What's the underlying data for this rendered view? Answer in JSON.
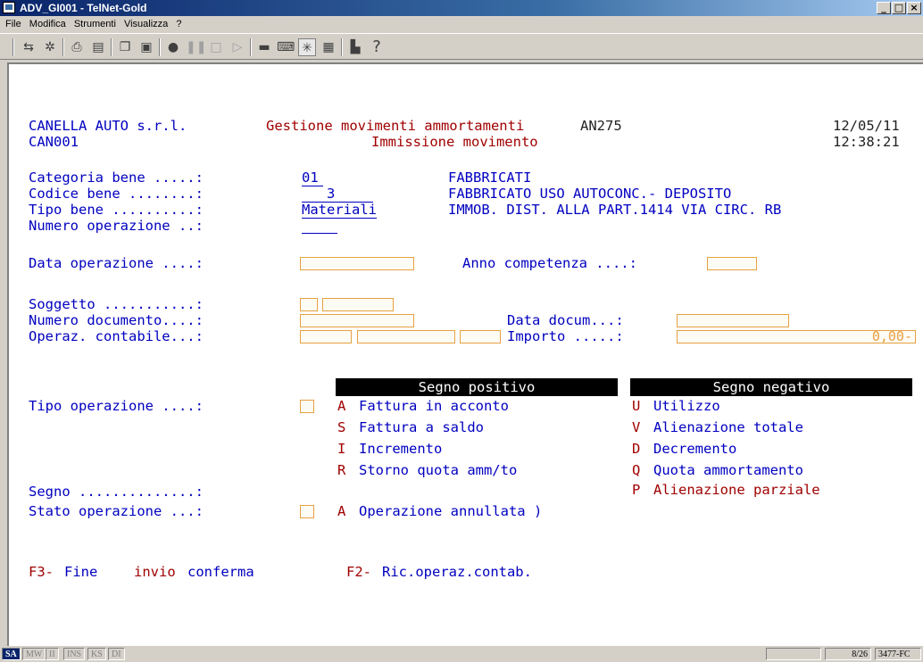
{
  "window": {
    "title": "ADV_GI001 - TelNet-Gold",
    "min": "_",
    "max": "□",
    "close": "×"
  },
  "menu": [
    "File",
    "Modifica",
    "Strumenti",
    "Visualizza",
    "?"
  ],
  "header": {
    "company": "CANELLA AUTO s.r.l.",
    "company_code": "CAN001",
    "program_title": "Gestione movimenti ammortamenti",
    "program_code": "AN275",
    "subtitle": "Immissione movimento",
    "date": "12/05/11",
    "time": "12:38:21"
  },
  "fields": {
    "categoria_label": "Categoria bene .....:",
    "categoria_value": "01",
    "categoria_desc": "FABBRICATI",
    "codice_label": "Codice bene ........:",
    "codice_value": "   3",
    "codice_desc": "FABBRICATO USO AUTOCONC.- DEPOSITO",
    "tipo_label": "Tipo bene ..........:",
    "tipo_value": "Materiali",
    "tipo_desc": "IMMOB. DIST. ALLA PART.1414 VIA CIRC. RB",
    "numero_label": "Numero operazione ..:",
    "data_label": "Data operazione ....:",
    "anno_label": "Anno competenza ....:",
    "soggetto_label": "Soggetto ...........:",
    "numdoc_label": "Numero documento....:",
    "datadoc_label": "Data docum...:",
    "operaz_label": "Operaz. contabile...:",
    "importo_label": "Importo .....:",
    "importo_value": "0,00-",
    "tipo_op_label": "Tipo operazione ....:",
    "segno_label": "Segno ..............:",
    "stato_label": "Stato operazione ...:"
  },
  "positive": {
    "header": "Segno  positivo",
    "options": [
      {
        "key": "A",
        "label": "Fattura in acconto"
      },
      {
        "key": "S",
        "label": "Fattura a saldo"
      },
      {
        "key": "I",
        "label": "Incremento"
      },
      {
        "key": "R",
        "label": "Storno quota amm/to"
      }
    ]
  },
  "negative": {
    "header": "Segno negativo",
    "options": [
      {
        "key": "U",
        "label": "Utilizzo"
      },
      {
        "key": "V",
        "label": "Alienazione totale"
      },
      {
        "key": "D",
        "label": "Decremento"
      },
      {
        "key": "Q",
        "label": "Quota ammortamento"
      },
      {
        "key": "P",
        "label": "Alienazione parziale"
      }
    ]
  },
  "stato_option": {
    "key": "A",
    "label": "Operazione annullata )"
  },
  "fkeys": {
    "f3_key": "F3-",
    "f3_label": "Fine",
    "enter_key": "invio",
    "enter_label": "conferma",
    "f2_key": "F2-",
    "f2_label": "Ric.operaz.contab."
  },
  "status": {
    "indicators": [
      "SA",
      "MW",
      "II",
      "INS",
      "KS",
      "DI"
    ],
    "position": "8/26",
    "session": "3477-FC"
  }
}
